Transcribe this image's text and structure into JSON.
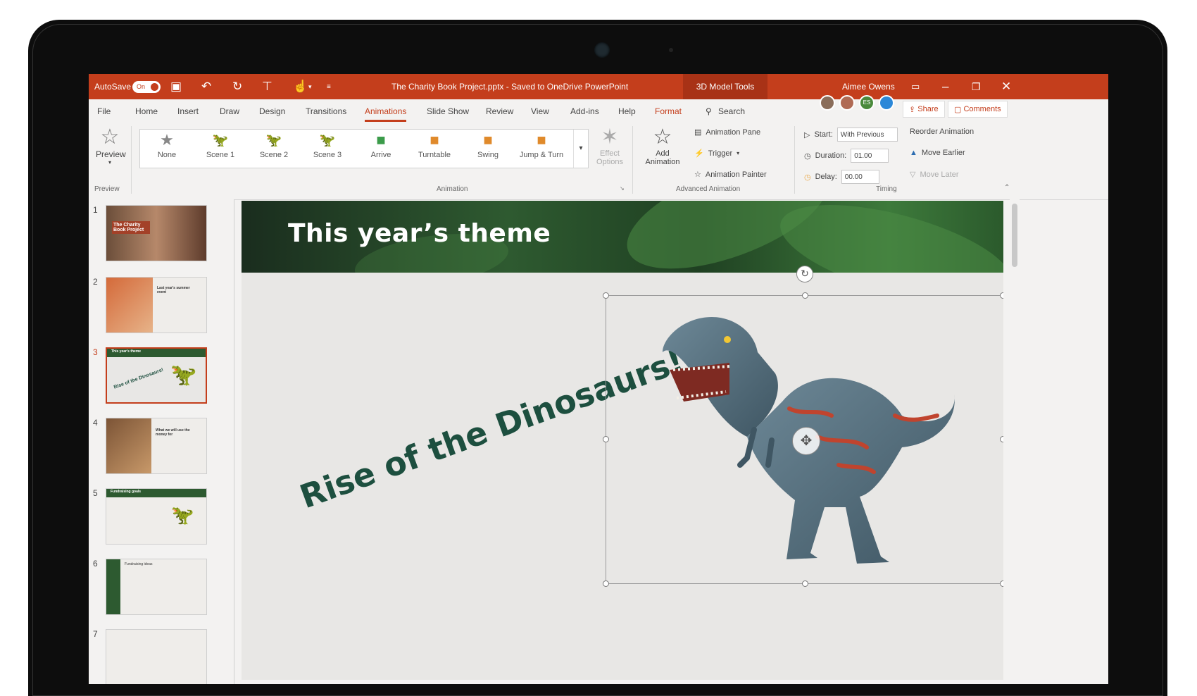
{
  "titlebar": {
    "autosave_label": "AutoSave",
    "toggle_label": "On",
    "document_title": "The Charity Book Project.pptx  -  Saved to OneDrive PowerPoint",
    "contextual_tab": "3D Model Tools",
    "user_name": "Aimee Owens"
  },
  "menu": {
    "tabs": [
      "File",
      "Home",
      "Insert",
      "Draw",
      "Design",
      "Transitions",
      "Animations",
      "Slide Show",
      "Review",
      "View",
      "Add-ins",
      "Help",
      "Format"
    ],
    "search_label": "Search",
    "share_label": "Share",
    "comments_label": "Comments",
    "avatar_initials": "ES"
  },
  "ribbon": {
    "preview_label": "Preview",
    "preview_group": "Preview",
    "gallery": [
      "None",
      "Scene 1",
      "Scene 2",
      "Scene 3",
      "Arrive",
      "Turntable",
      "Swing",
      "Jump & Turn"
    ],
    "effect_options": "Effect Options",
    "animation_group": "Animation",
    "add_animation": "Add Animation",
    "animation_pane": "Animation Pane",
    "trigger": "Trigger",
    "animation_painter": "Animation Painter",
    "advanced_group": "Advanced Animation",
    "start_label": "Start:",
    "start_value": "With Previous",
    "duration_label": "Duration:",
    "duration_value": "01.00",
    "delay_label": "Delay:",
    "delay_value": "00.00",
    "reorder_label": "Reorder Animation",
    "move_earlier": "Move Earlier",
    "move_later": "Move Later",
    "timing_group": "Timing"
  },
  "thumbnails": {
    "numbers": [
      "1",
      "2",
      "3",
      "4",
      "5",
      "6",
      "7"
    ],
    "t1_title": "The Charity Book Project",
    "t2_title": "Last year's summer event",
    "t3_title": "This year's theme",
    "t3_sub": "Rise of the Dinosaurs!",
    "t4_title": "What we will use the money for",
    "t5_title": "Fundraising goals",
    "t6_title": "Fundraising ideas"
  },
  "slide": {
    "title": "This year’s theme",
    "wordart": "Rise of the Dinosaurs!"
  },
  "colors": {
    "accent": "#c43e1c",
    "wordart": "#1d4f3f"
  }
}
